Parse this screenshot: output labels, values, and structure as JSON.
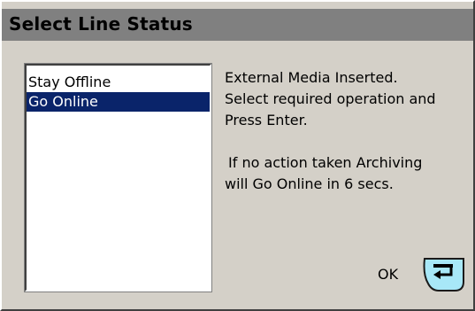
{
  "dialog": {
    "title": "Select Line Status",
    "list": {
      "items": [
        "Stay Offline",
        "Go Online"
      ],
      "selected_index": 1
    },
    "message": {
      "line1": "External Media Inserted.",
      "line2": "Select required operation and",
      "line3": "Press Enter.",
      "line4": "If no action taken Archiving",
      "line5": "will Go Online in 6 secs."
    },
    "ok_label": "OK",
    "enter_icon": "enter-key-icon",
    "colors": {
      "titlebar": "#808080",
      "background": "#d4d0c8",
      "selection": "#0a246a",
      "enter_icon_fill": "#a8e8f8"
    }
  }
}
